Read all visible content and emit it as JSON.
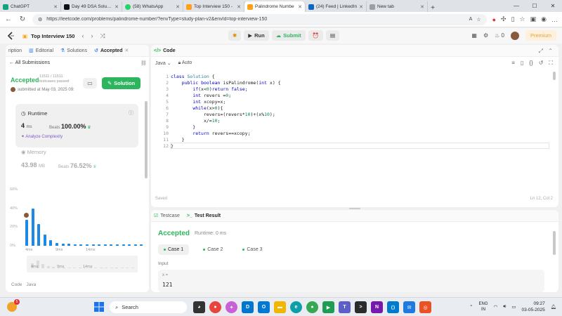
{
  "browser": {
    "tabs": [
      {
        "title": "ChatGPT",
        "color": "#10a37f"
      },
      {
        "title": "Day 49 DSA Solution",
        "color": "#111111"
      },
      {
        "title": "(58) WhatsApp",
        "color": "#25d366"
      },
      {
        "title": "Top Interview 150 -",
        "color": "#ffa116"
      },
      {
        "title": "Palindrome Numbe",
        "color": "#ffa116"
      },
      {
        "title": "(24) Feed | LinkedIn",
        "color": "#0a66c2"
      },
      {
        "title": "New tab",
        "color": "#9aa0a6"
      }
    ],
    "url": "https://leetcode.com/problems/palindrome-number/?envType=study-plan-v2&envId=top-interview-150"
  },
  "header": {
    "problem_list": "Top Interview 150",
    "run_label": "Run",
    "submit_label": "Submit",
    "streak": "0",
    "premium_label": "Premium"
  },
  "left": {
    "tabs": [
      {
        "label": "ription"
      },
      {
        "label": "Editorial"
      },
      {
        "label": "Solutions"
      },
      {
        "label": "Accepted"
      }
    ],
    "all_submissions": "All Submissions",
    "status": "Accepted",
    "passed_count": "11511 / 11511",
    "passed_label": "testcases passed",
    "submitted_at": "submitted at May 03, 2025 09:",
    "solution_label": "Solution",
    "runtime": {
      "title": "Runtime",
      "value": "4",
      "unit": "ms",
      "beats_label": "Beats",
      "beats": "100.00%",
      "analyze": "Analyze Complexity"
    },
    "memory": {
      "title": "Memory",
      "value": "43.98",
      "unit": "MB",
      "beats_label": "Beats",
      "beats": "76.52%"
    },
    "code_footer": [
      "Code",
      "Java"
    ]
  },
  "chart_data": {
    "type": "bar",
    "title": "",
    "xlabel": "",
    "ylabel": "",
    "yticks": [
      "60%",
      "40%",
      "20%",
      "0%"
    ],
    "xticks": [
      "4ms",
      "9ms",
      "14ms"
    ],
    "minimap_xticks": [
      "4ms",
      "9ms",
      "14ms"
    ],
    "ylim": [
      0,
      60
    ],
    "values": [
      28,
      40,
      23,
      12,
      6,
      3,
      2,
      2,
      1.5,
      1.5,
      1.5,
      1.5,
      1.5,
      1.5,
      1.5,
      1.5,
      1.5,
      1.5,
      1.5,
      1.5
    ],
    "color": "#1e88e5"
  },
  "code_panel": {
    "title": "Code",
    "language": "Java",
    "mode": "Auto",
    "lines": [
      "class Solution {",
      "    public boolean isPalindrome(int x) {",
      "        if(x<0)return false;",
      "        int revers =0;",
      "        int xcopy=x;",
      "        while(x>0){",
      "            revers=(revers*10)+(x%10);",
      "            x/=10;",
      "        }",
      "        return revers==xcopy;",
      "    }",
      "}"
    ],
    "saved": "Saved",
    "cursor": "Ln 12, Col 2"
  },
  "result": {
    "tabs": [
      {
        "label": "Testcase"
      },
      {
        "label": "Test Result"
      }
    ],
    "status": "Accepted",
    "runtime": "Runtime: 0 ms",
    "cases": [
      "Case 1",
      "Case 2",
      "Case 3"
    ],
    "input_label": "Input",
    "var_name": "x =",
    "var_value": "121"
  },
  "taskbar": {
    "weather_badge": "5",
    "search_placeholder": "Search",
    "lang_top": "ENG",
    "lang_bottom": "IN",
    "time": "09:27",
    "date": "03-05-2025"
  }
}
